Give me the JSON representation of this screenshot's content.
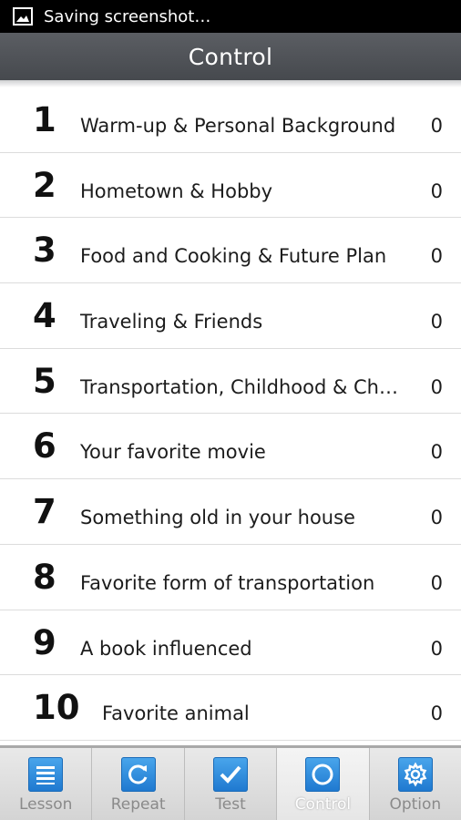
{
  "status_bar": {
    "notification_icon": "image-icon",
    "text": "Saving screenshot…"
  },
  "header": {
    "title": "Control"
  },
  "lessons": [
    {
      "number": "1",
      "title": "Warm-up & Personal Background",
      "score": "0"
    },
    {
      "number": "2",
      "title": "Hometown & Hobby",
      "score": "0"
    },
    {
      "number": "3",
      "title": "Food and Cooking & Future Plan",
      "score": "0"
    },
    {
      "number": "4",
      "title": "Traveling & Friends",
      "score": "0"
    },
    {
      "number": "5",
      "title": "Transportation, Childhood & Ch…",
      "score": "0"
    },
    {
      "number": "6",
      "title": "Your favorite movie",
      "score": "0"
    },
    {
      "number": "7",
      "title": "Something old in your house",
      "score": "0"
    },
    {
      "number": "8",
      "title": "Favorite form of transportation",
      "score": "0"
    },
    {
      "number": "9",
      "title": "A book influenced",
      "score": "0"
    },
    {
      "number": "10",
      "title": "Favorite animal",
      "score": "0"
    }
  ],
  "tabs": [
    {
      "label": "Lesson",
      "icon": "list-icon"
    },
    {
      "label": "Repeat",
      "icon": "repeat-icon"
    },
    {
      "label": "Test",
      "icon": "checkmark-icon"
    },
    {
      "label": "Control",
      "icon": "circle-icon",
      "active": true
    },
    {
      "label": "Option",
      "icon": "gear-icon"
    }
  ],
  "colors": {
    "header_bg": "#4e5156",
    "tab_icon_blue": "#2b8ee0",
    "active_tab_label": "#ffffff"
  }
}
